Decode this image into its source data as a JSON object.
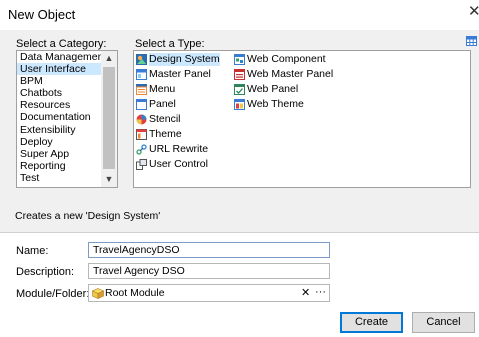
{
  "window": {
    "title": "New Object"
  },
  "category_section": {
    "label": "Select a Category:",
    "items": [
      "Data Management",
      "User Interface",
      "BPM",
      "Chatbots",
      "Resources",
      "Documentation",
      "Extensibility",
      "Deploy",
      "Super App",
      "Reporting",
      "Test"
    ],
    "selected": "User Interface"
  },
  "type_section": {
    "label": "Select a Type:",
    "items": [
      {
        "label": "Design System",
        "icon": "design-system-icon"
      },
      {
        "label": "Master Panel",
        "icon": "master-panel-icon"
      },
      {
        "label": "Menu",
        "icon": "menu-icon"
      },
      {
        "label": "Panel",
        "icon": "panel-icon"
      },
      {
        "label": "Stencil",
        "icon": "stencil-icon"
      },
      {
        "label": "Theme",
        "icon": "theme-icon"
      },
      {
        "label": "URL Rewrite",
        "icon": "url-rewrite-icon"
      },
      {
        "label": "User Control",
        "icon": "user-control-icon"
      },
      {
        "label": "Web Component",
        "icon": "web-component-icon"
      },
      {
        "label": "Web Master Panel",
        "icon": "web-master-panel-icon"
      },
      {
        "label": "Web Panel",
        "icon": "web-panel-icon"
      },
      {
        "label": "Web Theme",
        "icon": "web-theme-icon"
      }
    ],
    "selected": "Design System"
  },
  "description_text": "Creates a new 'Design System'",
  "form": {
    "name_label": "Name:",
    "name_value": "TravelAgencyDSO",
    "description_label": "Description:",
    "description_value": "Travel Agency DSO",
    "module_label": "Module/Folder:",
    "module_value": "Root Module",
    "clear_symbol": "✕",
    "more_symbol": "···"
  },
  "buttons": {
    "create": "Create",
    "cancel": "Cancel"
  },
  "colors": {
    "selection": "#cce8ff",
    "panel": "#f0f0f0",
    "accent": "#0078d7"
  }
}
